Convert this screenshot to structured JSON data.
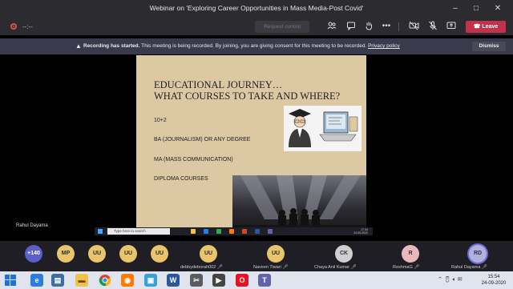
{
  "window": {
    "title": "Webinar on 'Exploring Career Opportunities in Mass Media-Post Covid'"
  },
  "toolbar": {
    "timer": "--:--",
    "request_control": "Request control",
    "leave": "Leave",
    "icons": [
      "participants-icon",
      "chat-icon",
      "raise-hand-icon",
      "more-icon",
      "camera-off-icon",
      "mic-off-icon",
      "share-tray-icon"
    ]
  },
  "banner": {
    "bold": "Recording has started.",
    "text": "This meeting is being recorded. By joining, you are giving consent for this meeting to be recorded.",
    "link": "Privacy policy",
    "dismiss": "Dismiss"
  },
  "slide": {
    "title_line1": "EDUCATIONAL JOURNEY…",
    "title_line2": "WHAT COURSES TO TAKE AND WHERE?",
    "items": [
      "10+2",
      "BA (JOURNALISM) OR ANY DEGREE",
      "MA (MASS COMMUNICATION)",
      "DIPLOMA COURSES"
    ]
  },
  "speaker": {
    "name": "Rahul Dayama"
  },
  "shared_screen": {
    "search_placeholder": "Type here to search",
    "clock_time": "17:34",
    "clock_date": "24-09-2020"
  },
  "roster": {
    "overflow": "+140",
    "attendees": [
      {
        "initials": "MP",
        "name": ""
      },
      {
        "initials": "UU",
        "name": ""
      },
      {
        "initials": "UU",
        "name": ""
      },
      {
        "initials": "UU",
        "name": ""
      },
      {
        "initials": "UU",
        "name": "debbydeborah002"
      },
      {
        "initials": "UU",
        "name": "Naveen Tiwari"
      },
      {
        "initials": "CK",
        "name": "Chaya Anil Kumar"
      },
      {
        "initials": "R",
        "name": "ReshmaG"
      },
      {
        "initials": "RD",
        "name": "Rahul Dayama"
      }
    ]
  },
  "os": {
    "time": "15:54",
    "date": "24-09-2020"
  },
  "colors": {
    "leave": "#c4314b",
    "count_avatar": "#5b5fc7",
    "slide_bg": "#dcc8a3"
  }
}
